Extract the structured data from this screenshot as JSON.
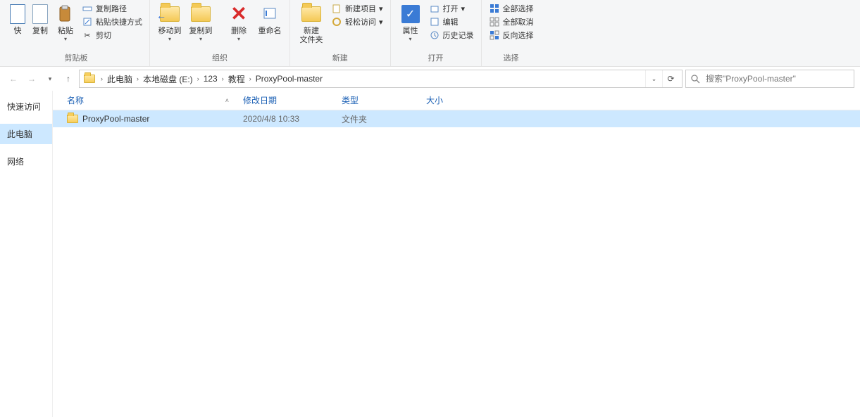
{
  "ribbon": {
    "clipboard": {
      "label": "剪贴板",
      "pin_fast": "快",
      "copy": "复制",
      "paste": "粘贴",
      "copy_path": "复制路径",
      "paste_shortcut": "粘贴快捷方式",
      "cut": "剪切"
    },
    "organize": {
      "label": "组织",
      "move_to": "移动到",
      "copy_to": "复制到",
      "delete": "删除",
      "rename": "重命名"
    },
    "new": {
      "label": "新建",
      "new_folder": "新建\n文件夹",
      "new_item": "新建项目",
      "easy_access": "轻松访问"
    },
    "open": {
      "label": "打开",
      "properties": "属性",
      "open": "打开",
      "edit": "编辑",
      "history": "历史记录"
    },
    "select": {
      "label": "选择",
      "select_all": "全部选择",
      "select_none": "全部取消",
      "invert": "反向选择"
    }
  },
  "breadcrumb": {
    "segments": [
      "此电脑",
      "本地磁盘 (E:)",
      "123",
      "教程",
      "ProxyPool-master"
    ]
  },
  "search": {
    "placeholder": "搜索\"ProxyPool-master\""
  },
  "sidebar": {
    "items": [
      {
        "label": "快速访问",
        "selected": false
      },
      {
        "label": "此电脑",
        "selected": true
      },
      {
        "label": "网络",
        "selected": false
      }
    ]
  },
  "columns": {
    "name": "名称",
    "date": "修改日期",
    "type": "类型",
    "size": "大小"
  },
  "rows": [
    {
      "name": "ProxyPool-master",
      "date": "2020/4/8 10:33",
      "type": "文件夹",
      "size": ""
    }
  ]
}
